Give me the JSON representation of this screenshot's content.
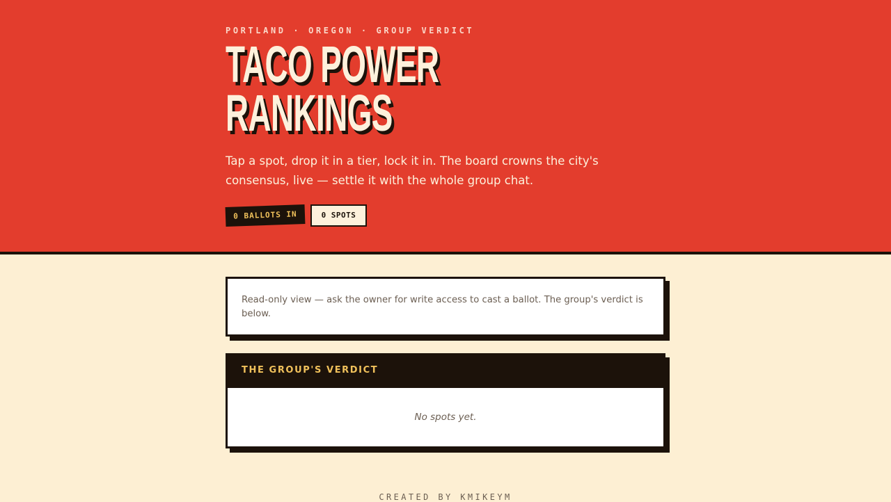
{
  "hero": {
    "eyebrow": "PORTLAND · OREGON · GROUP VERDICT",
    "title_line1": "TACO POWER",
    "title_line2": "RANKINGS",
    "lede": "Tap a spot, drop it in a tier, lock it in. The board crowns the city's consensus, live — settle it with the whole group chat.",
    "ballots_badge": "0 BALLOTS IN",
    "spots_badge": "0 SPOTS"
  },
  "notice": {
    "text": "Read-only view — ask the owner for write access to cast a ballot. The group's verdict is below."
  },
  "verdict": {
    "heading": "THE GROUP'S VERDICT",
    "empty_text": "No spots yet."
  },
  "footer": {
    "credit": "CREATED BY KMIKEYM"
  },
  "colors": {
    "hero_background": "#e33d2d",
    "page_background": "#fdefd3",
    "ink": "#1c120a",
    "accent_gold": "#f0c15b",
    "cream": "#fdf1dc"
  }
}
